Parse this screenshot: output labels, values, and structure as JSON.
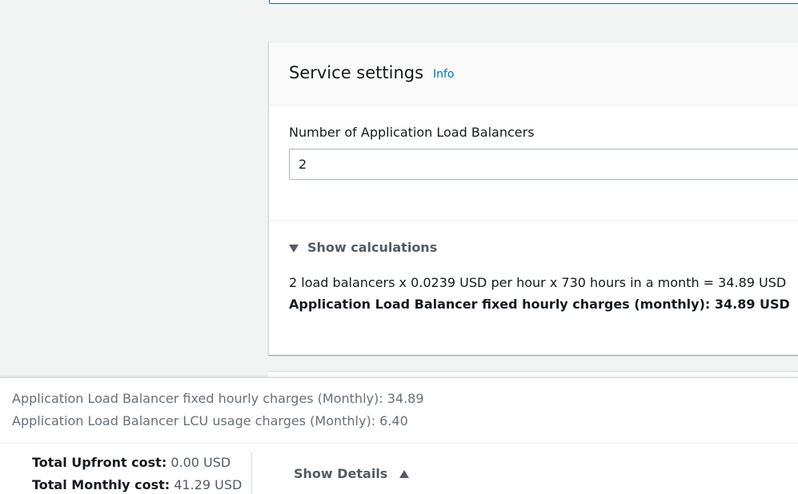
{
  "service_settings": {
    "title": "Service settings",
    "info_link": "Info",
    "field_label": "Number of Application Load Balancers",
    "field_value": "2"
  },
  "calculations": {
    "toggle_label": "Show calculations",
    "toggle_icon": "caret-down-icon",
    "formula": "2 load balancers x 0.0239 USD per hour x 730 hours in a month = 34.89 USD",
    "result": "Application Load Balancer fixed hourly charges (monthly): 34.89 USD"
  },
  "summary": {
    "lines": [
      "Application Load Balancer fixed hourly charges (Monthly): 34.89",
      "Application Load Balancer LCU usage charges (Monthly): 6.40"
    ],
    "upfront_label": "Total Upfront cost:",
    "upfront_value": "0.00 USD",
    "monthly_label": "Total Monthly cost:",
    "monthly_value": "41.29 USD",
    "details_label": "Show Details",
    "details_icon": "caret-up-icon"
  },
  "colors": {
    "accent_link": "#0073bb",
    "page_background": "#f2f3f3",
    "muted_text": "#687078"
  }
}
